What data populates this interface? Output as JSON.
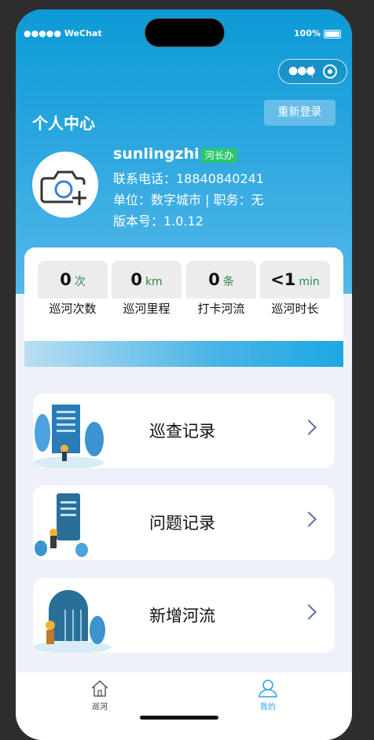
{
  "status": {
    "carrier": "●●●●● WeChat",
    "battery": "100%"
  },
  "header": {
    "title": "个人中心",
    "relogin_label": "重新登录"
  },
  "profile": {
    "username": "sunlingzhi",
    "badge": "河长办",
    "phone": "联系电话：18840840241",
    "org": "单位：数字城市 | 职务：无",
    "version": "版本号：1.0.12"
  },
  "stats": [
    {
      "value": "0",
      "unit": "次",
      "label": "巡河次数"
    },
    {
      "value": "0",
      "unit": "km",
      "label": "巡河里程"
    },
    {
      "value": "0",
      "unit": "条",
      "label": "打卡河流"
    },
    {
      "value": "<1",
      "unit": "min",
      "label": "巡河时长"
    }
  ],
  "menu": [
    {
      "label": "巡查记录"
    },
    {
      "label": "问题记录"
    },
    {
      "label": "新增河流"
    }
  ],
  "tabbar": [
    {
      "label": "巡河",
      "icon": "home-icon",
      "active": false
    },
    {
      "label": "我的",
      "icon": "user-icon",
      "active": true
    }
  ],
  "colors": {
    "accent": "#1da8e2",
    "badge": "#2bc86b",
    "active_tab": "#2ba3e3"
  }
}
